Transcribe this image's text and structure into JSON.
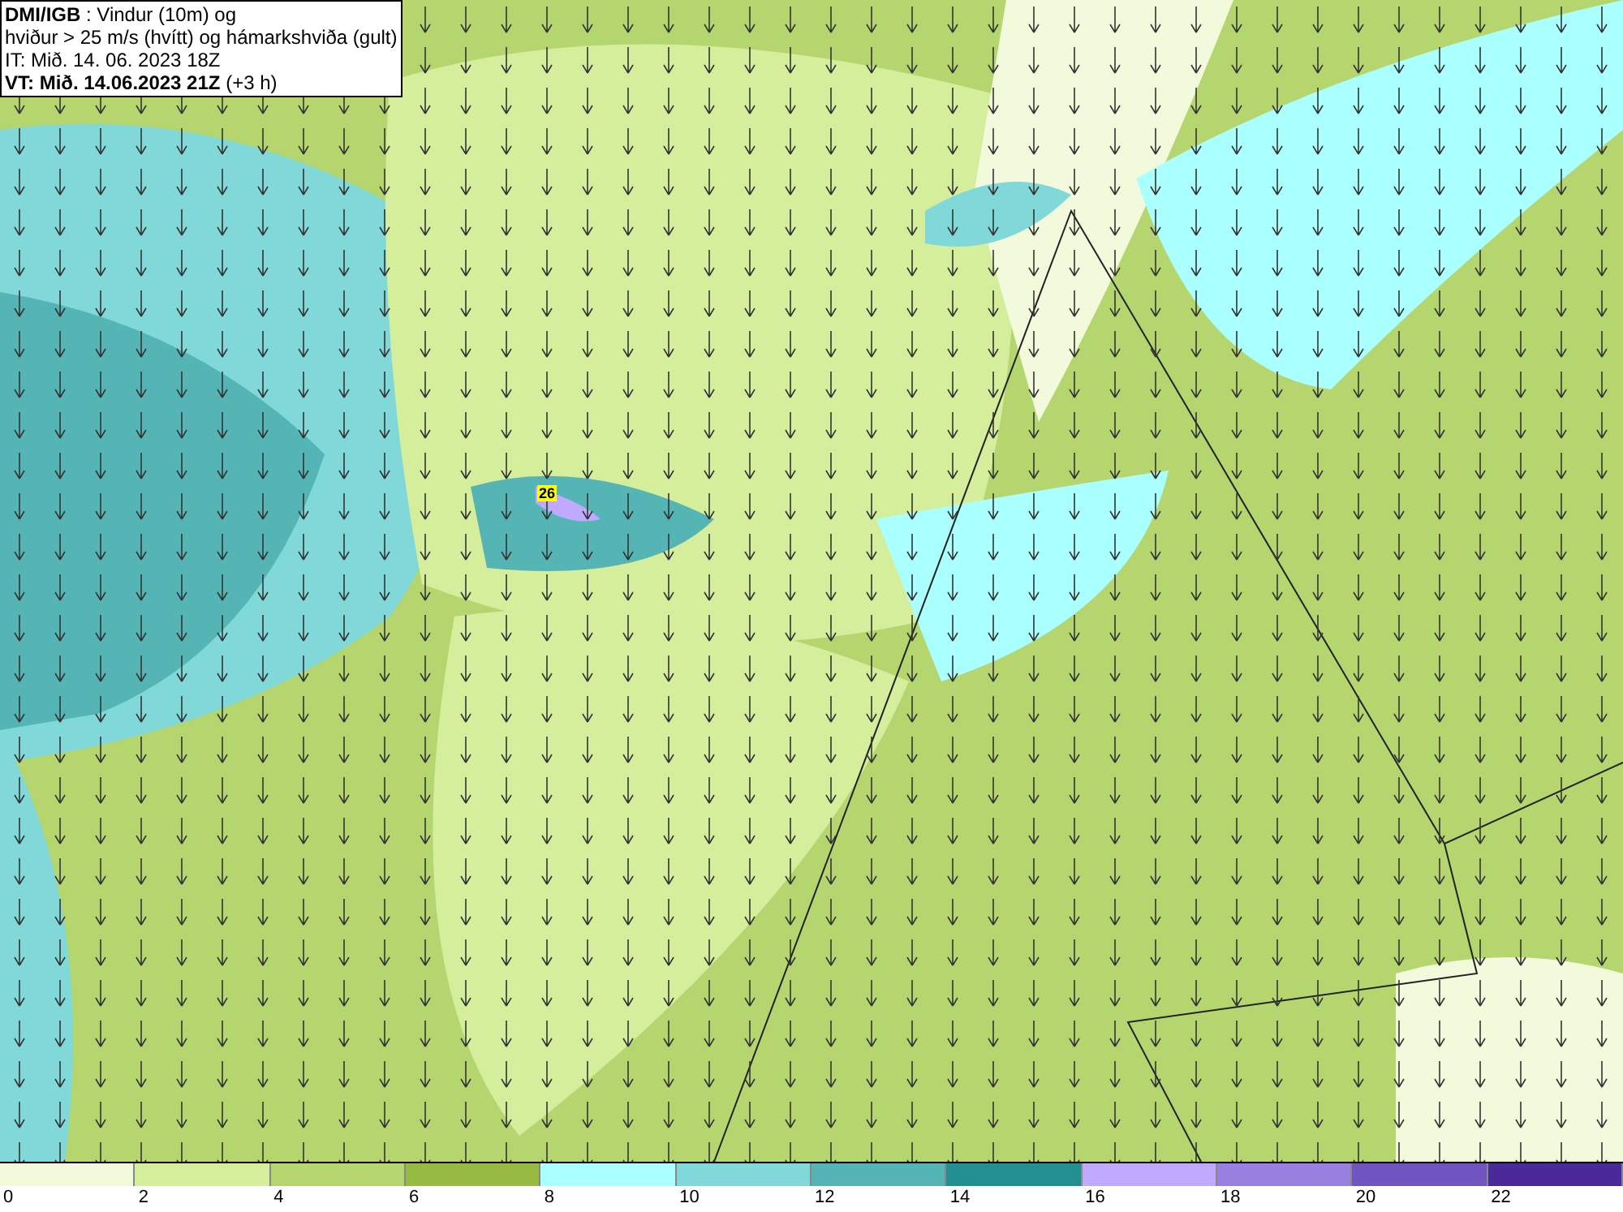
{
  "header": {
    "lines": [
      "**DMI/IGB** : Vindur (10m) og",
      "hviður > 25 m/s (hvítt) og hámarkshviða (gult)",
      "IT: Mið. 14. 06. 2023 18Z",
      "**VT: Mið. 14.06.2023 21Z** (+3 h)"
    ]
  },
  "map": {
    "gust_label": "26"
  },
  "legend": [
    {
      "label": "0",
      "color": "#f3fadc"
    },
    {
      "label": "2",
      "color": "#d4ee9c"
    },
    {
      "label": "4",
      "color": "#b5d66e"
    },
    {
      "label": "6",
      "color": "#96ba42"
    },
    {
      "label": "8",
      "color": "#aaffff"
    },
    {
      "label": "10",
      "color": "#80d8d8"
    },
    {
      "label": "12",
      "color": "#55b4b4"
    },
    {
      "label": "14",
      "color": "#229090"
    },
    {
      "label": "16",
      "color": "#c0aaff"
    },
    {
      "label": "18",
      "color": "#9980e0"
    },
    {
      "label": "20",
      "color": "#7055c0"
    },
    {
      "label": "22",
      "color": "#4a2a9a"
    }
  ]
}
